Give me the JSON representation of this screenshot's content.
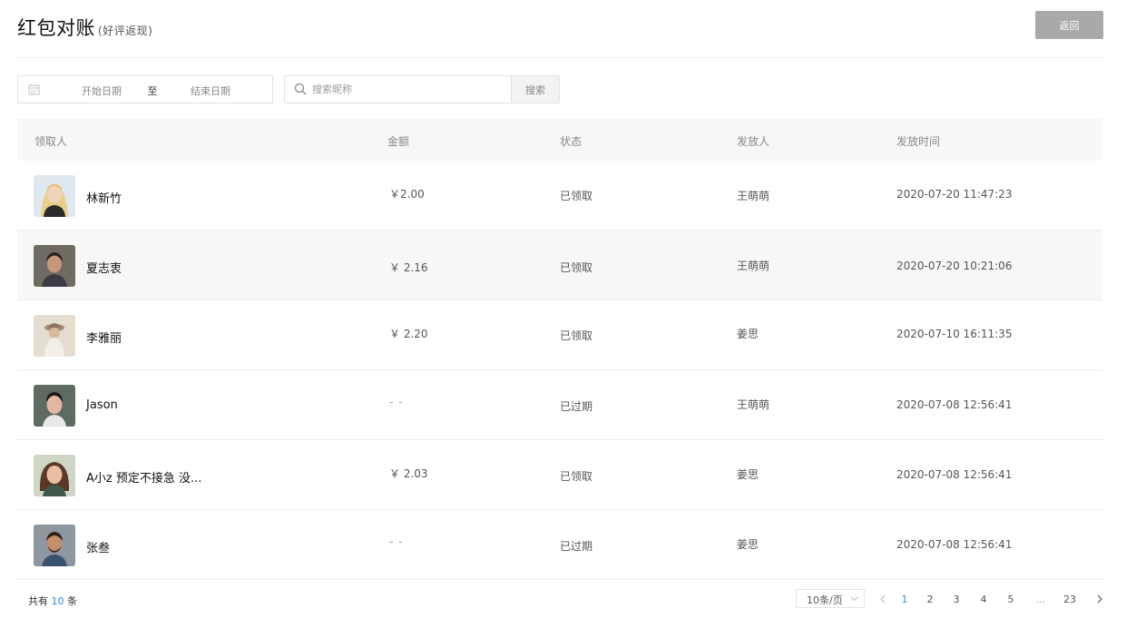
{
  "header": {
    "title": "红包对账",
    "subtitle": "(好评返现)",
    "back_label": "返回"
  },
  "filters": {
    "start_date": "开始日期",
    "range_sep": "至",
    "end_date": "结束日期",
    "search_placeholder": "搜索昵称",
    "search_label": "搜索"
  },
  "table": {
    "headers": {
      "recipient": "领取人",
      "amount": "金额",
      "status": "状态",
      "issuer": "发放人",
      "time": "发放时间"
    },
    "rows": [
      {
        "name": "林新竹",
        "amount": "￥2.00",
        "status": "已领取",
        "issuer": "王萌萌",
        "time": "2020-07-20 11:47:23"
      },
      {
        "name": "夏志衷",
        "amount": "￥ 2.16",
        "status": "已领取",
        "issuer": "王萌萌",
        "time": "2020-07-20 10:21:06"
      },
      {
        "name": "李雅丽",
        "amount": "￥ 2.20",
        "status": "已领取",
        "issuer": "姜思",
        "time": "2020-07-10 16:11:35"
      },
      {
        "name": "Jason",
        "amount": "- -",
        "status": "已过期",
        "issuer": "王萌萌",
        "time": "2020-07-08 12:56:41"
      },
      {
        "name": "A小z 预定不接急 没...",
        "amount": "￥ 2.03",
        "status": "已领取",
        "issuer": "姜思",
        "time": "2020-07-08 12:56:41"
      },
      {
        "name": "张叁",
        "amount": "- -",
        "status": "已过期",
        "issuer": "姜思",
        "time": "2020-07-08 12:56:41"
      }
    ]
  },
  "footer": {
    "total_prefix": "共有",
    "total_count": "10",
    "total_suffix": "条",
    "page_size": "10条/页",
    "pages": [
      "1",
      "2",
      "3",
      "4",
      "5",
      "...",
      "23"
    ],
    "current_page": "1"
  },
  "colors": {
    "accent": "#2d8cf0",
    "back_button": "#a9a9a9",
    "header_bg": "#f7f7f7"
  }
}
